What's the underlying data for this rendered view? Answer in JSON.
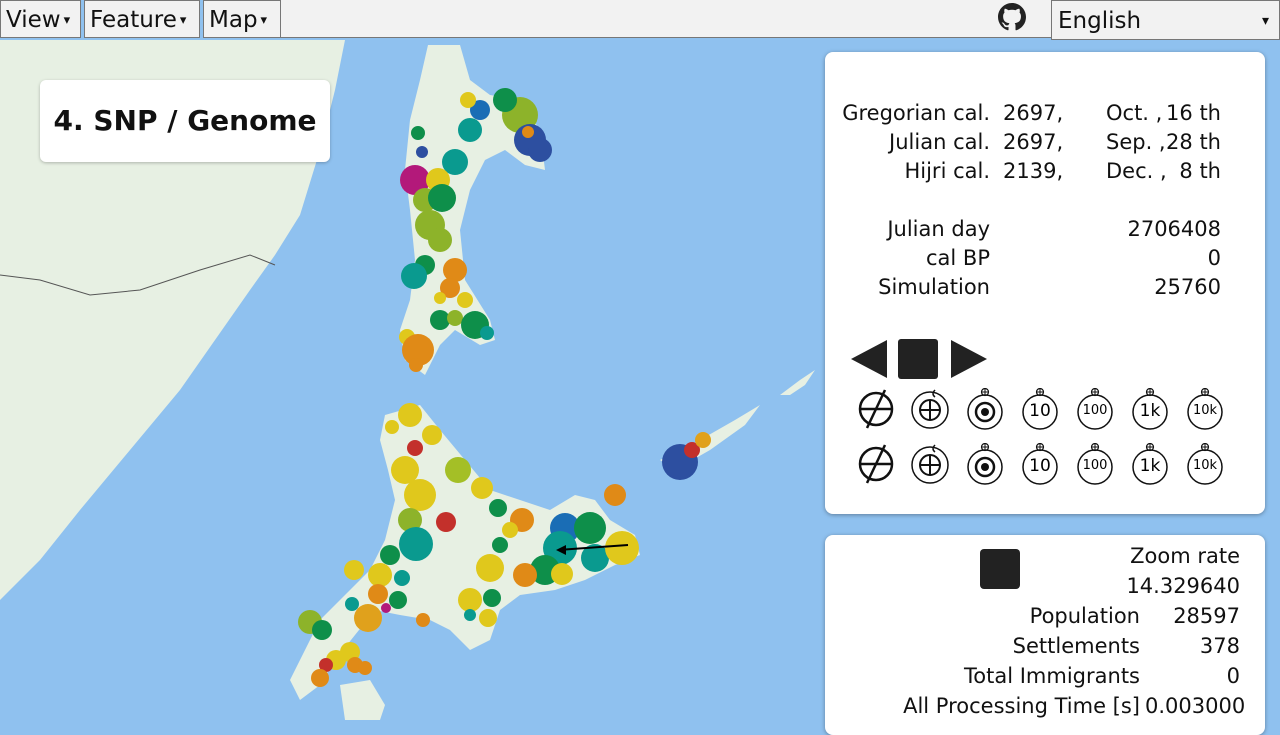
{
  "menu": {
    "view_label": "View",
    "feature_label": "Feature",
    "map_label": "Map",
    "arrow": "▾"
  },
  "language": {
    "selected": "English",
    "arrow": "▾"
  },
  "github_icon": "github-icon",
  "stage_title": "4. SNP / Genome",
  "calendar": {
    "rows": [
      {
        "name": "Gregorian cal.",
        "year": "2697,",
        "month": "Oct. ,",
        "day": "16 th"
      },
      {
        "name": "Julian cal.",
        "year": "2697,",
        "month": "Sep. ,",
        "day": "28 th"
      },
      {
        "name": "Hijri cal.",
        "year": "2139,",
        "month": "Dec. ,",
        "day": "8 th"
      }
    ],
    "julian_day_label": "Julian day",
    "julian_day_value": "2706408",
    "cal_bp_label": "cal BP",
    "cal_bp_value": "0",
    "simulation_label": "Simulation",
    "simulation_value": "25760"
  },
  "controls": {
    "play_back": "play-back-icon",
    "stop": "stop-icon",
    "play_forward": "play-forward-icon",
    "rows": [
      [
        "×",
        "+",
        "◎",
        "10",
        "100",
        "1k",
        "10k"
      ],
      [
        "×",
        "+",
        "◎",
        "10",
        "100",
        "1k",
        "10k"
      ]
    ]
  },
  "stats": {
    "zoom_label": "Zoom rate",
    "zoom_value": "14.329640",
    "population_label": "Population",
    "population_value": "28597",
    "settlements_label": "Settlements",
    "settlements_value": "378",
    "immigrants_label": "Total Immigrants",
    "immigrants_value": "0",
    "processing_label": "All Processing Time [s]",
    "processing_value": "0.003000"
  },
  "colors": {
    "sea": "#8fc1ef",
    "land": "#e9f2e6",
    "panel": "#ffffff",
    "dark": "#222222"
  }
}
